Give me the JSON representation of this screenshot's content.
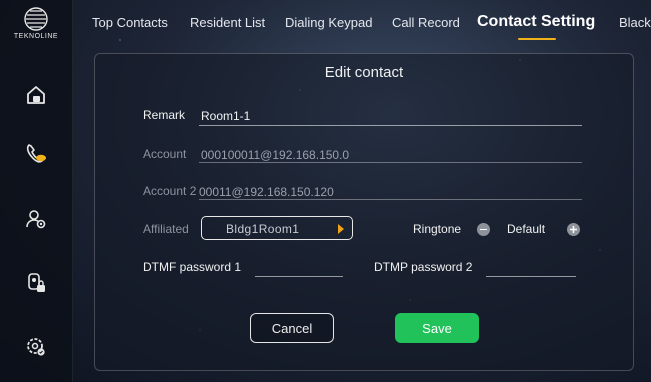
{
  "sidebar": {
    "logo_text": "TEKNOLINE",
    "items": [
      {
        "icon": "home-icon"
      },
      {
        "icon": "phone-icon",
        "active": true
      },
      {
        "icon": "user-settings-icon"
      },
      {
        "icon": "device-lock-icon"
      },
      {
        "icon": "settings-icon"
      }
    ],
    "accent_color": "#f0b21b"
  },
  "tabs": [
    {
      "label": "Top Contacts"
    },
    {
      "label": "Resident List"
    },
    {
      "label": "Dialing Keypad"
    },
    {
      "label": "Call Record"
    },
    {
      "label": "Contact Setting",
      "active": true
    },
    {
      "label": "Black"
    }
  ],
  "dialog": {
    "title": "Edit contact",
    "remark_label": "Remark",
    "remark_value": "Room1-1",
    "account_label": "Account",
    "account_value": "000100011@192.168.150.0",
    "account2_label": "Account 2",
    "account2_value": "00011@192.168.150.120",
    "affiliated_label": "Affiliated",
    "affiliated_value": "Bldg1Room1",
    "ringtone_label": "Ringtone",
    "ringtone_value": "Default",
    "dtmf1_label": "DTMF password 1",
    "dtmf1_value": "",
    "dtmp2_label": "DTMP password 2",
    "dtmp2_value": "",
    "cancel_label": "Cancel",
    "save_label": "Save",
    "save_color": "#22c25a"
  }
}
